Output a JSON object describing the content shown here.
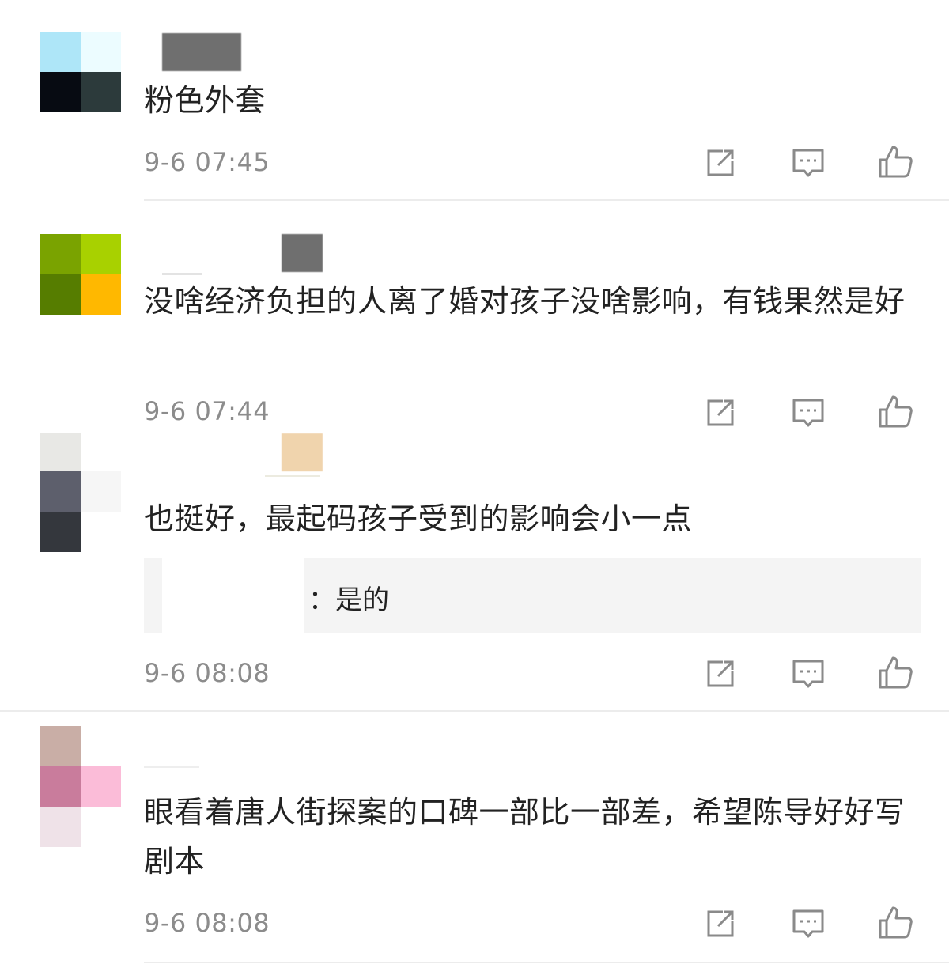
{
  "comments": [
    {
      "text": "粉色外套",
      "time": "9-6 07:45",
      "avatar_colors": [
        "#aee6f8",
        "#ecfcff",
        "#070b12",
        "#2c3a3b"
      ]
    },
    {
      "text": "没啥经济负担的人离了婚对孩子没啥影响，有钱果然是好",
      "time": "9-6 07:44",
      "avatar_colors": [
        "#7aa300",
        "#a8d100",
        "#567d00",
        "#ffb800"
      ]
    },
    {
      "text": "也挺好，最起码孩子受到的影响会小一点",
      "time": "9-6 08:08",
      "avatar_colors": [
        "#e8e8e5",
        "#ffffff",
        "#5d5f6c",
        "#f6f6f6",
        "#34373d",
        "#ffffff"
      ],
      "reply": {
        "text": "：是的"
      }
    },
    {
      "text": "眼看着唐人街探案的口碑一部比一部差，希望陈导好好写剧本",
      "time": "9-6 08:08",
      "avatar_colors": [
        "#c9aea6",
        "#ffffff",
        "#c97c9c",
        "#fbbcd8",
        "#efe2e8",
        "#ffffff"
      ]
    }
  ],
  "icons": {
    "share": "share-icon",
    "reply": "comment-icon",
    "like": "thumbs-up-icon"
  },
  "colors": {
    "text": "#222222",
    "meta": "#8c8c8c",
    "divider": "#ececec",
    "reply_bg": "#f4f4f4"
  }
}
